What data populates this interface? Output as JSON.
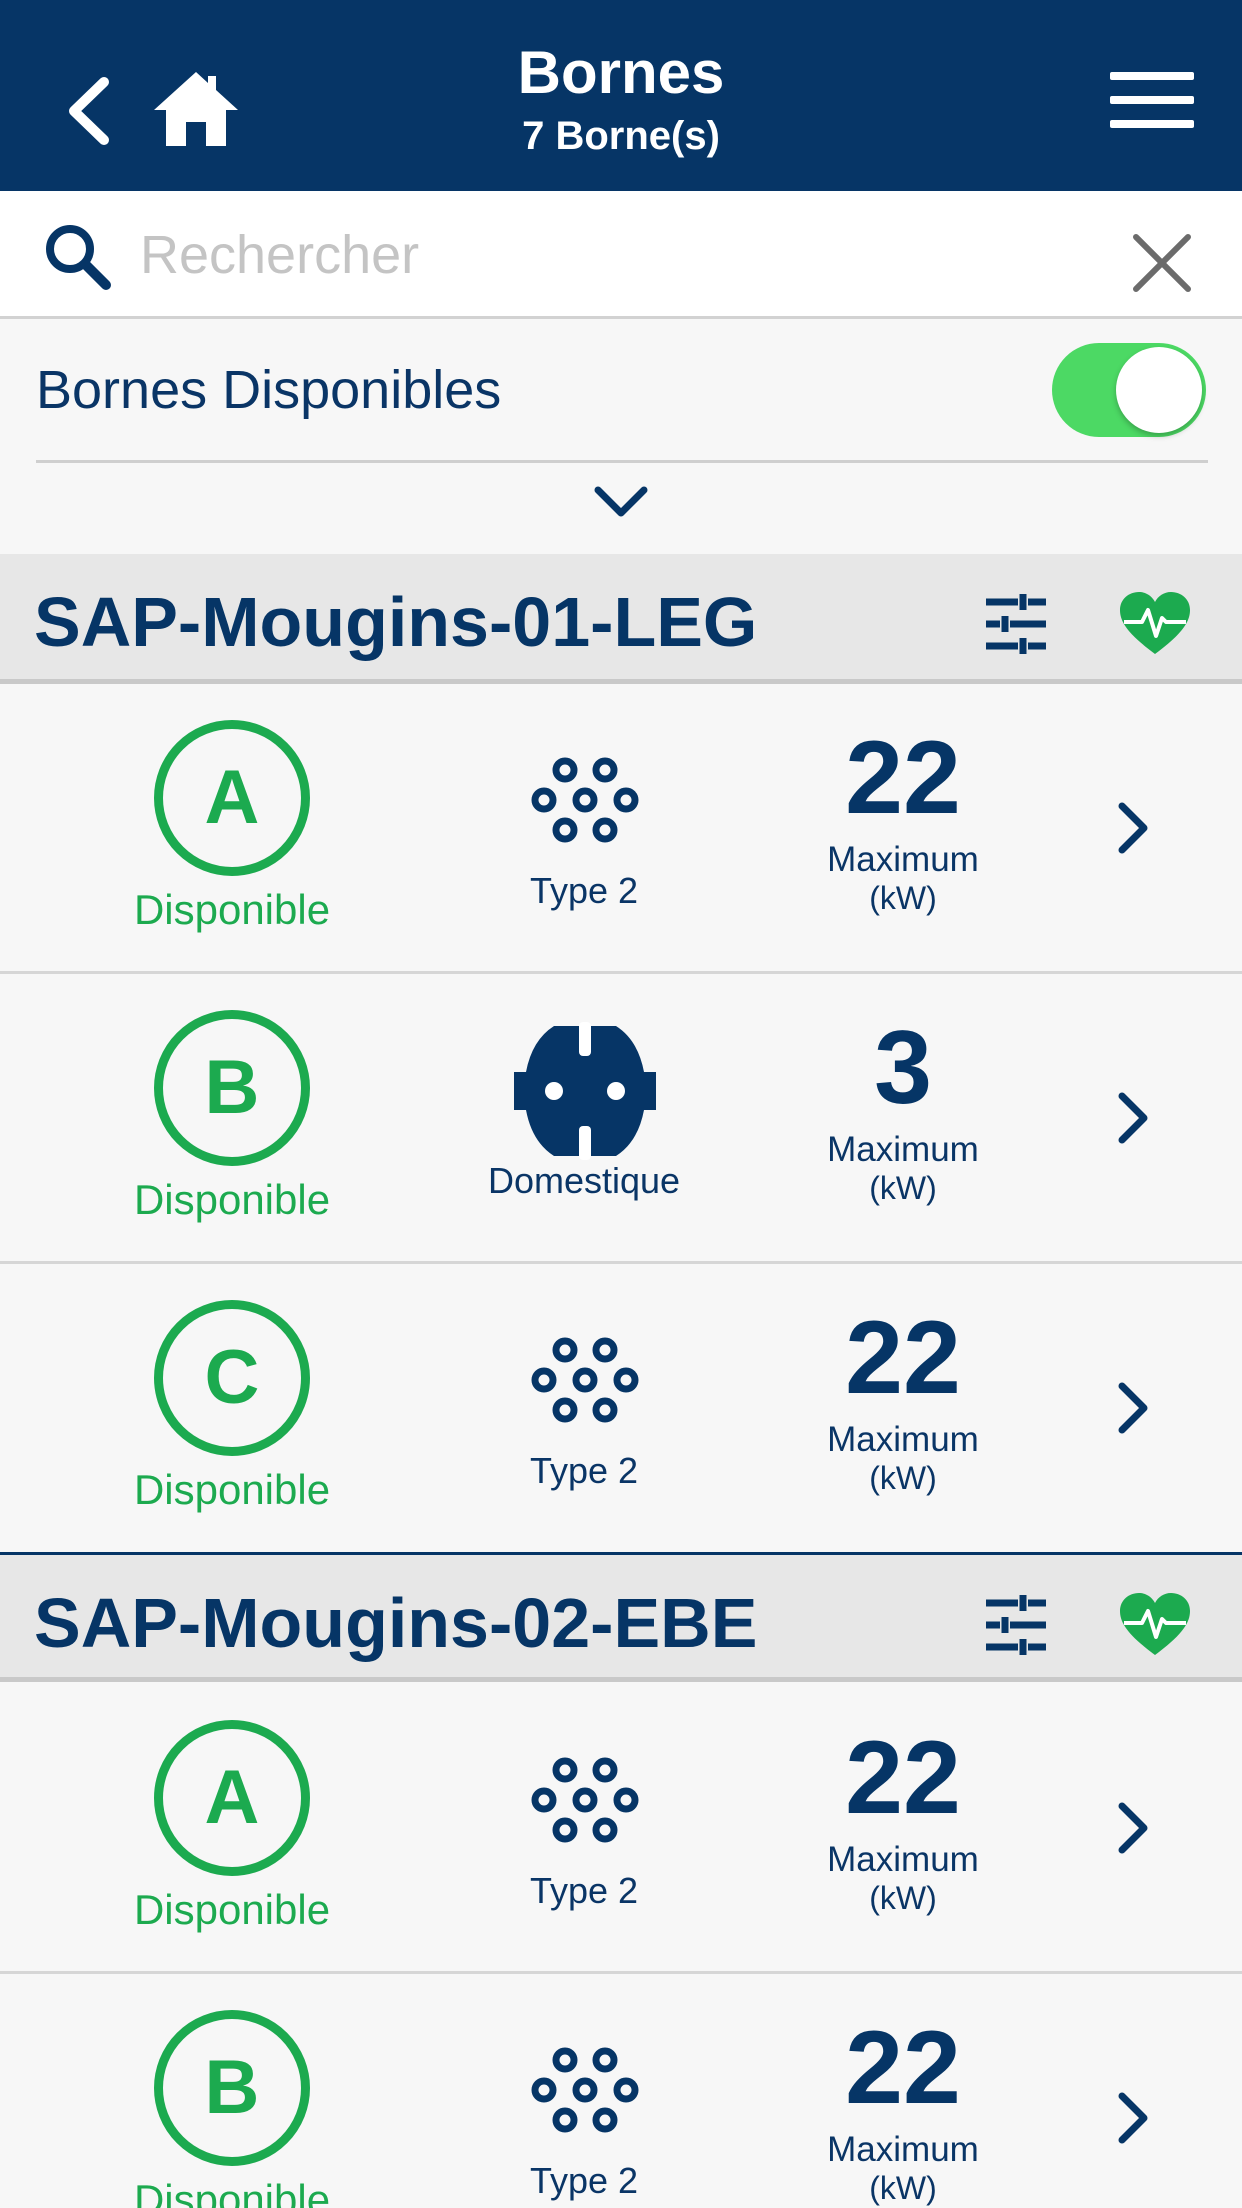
{
  "header": {
    "title": "Bornes",
    "subtitle": "7 Borne(s)",
    "back_icon": "chevron-left-icon",
    "home_icon": "home-icon",
    "menu_icon": "hamburger-menu-icon"
  },
  "search": {
    "placeholder": "Rechercher",
    "value": ""
  },
  "filter": {
    "label": "Bornes Disponibles",
    "toggle_on": true
  },
  "colors": {
    "navbar": "#063566",
    "available_green": "#1caa4f",
    "toggle_green": "#4cd964",
    "section_bg": "#e7e7e7"
  },
  "stations": [
    {
      "name": "SAP-Mougins-01-LEG",
      "points": [
        {
          "letter": "A",
          "status": "Disponible",
          "connector": "Type 2",
          "power": "22",
          "max_label": "Maximum",
          "unit": "(kW)"
        },
        {
          "letter": "B",
          "status": "Disponible",
          "connector": "Domestique",
          "power": "3",
          "max_label": "Maximum",
          "unit": "(kW)"
        },
        {
          "letter": "C",
          "status": "Disponible",
          "connector": "Type 2",
          "power": "22",
          "max_label": "Maximum",
          "unit": "(kW)"
        }
      ]
    },
    {
      "name": "SAP-Mougins-02-EBE",
      "points": [
        {
          "letter": "A",
          "status": "Disponible",
          "connector": "Type 2",
          "power": "22",
          "max_label": "Maximum",
          "unit": "(kW)"
        },
        {
          "letter": "B",
          "status": "Disponible",
          "connector": "Type 2",
          "power": "22",
          "max_label": "Maximum",
          "unit": "(kW)"
        }
      ]
    }
  ]
}
